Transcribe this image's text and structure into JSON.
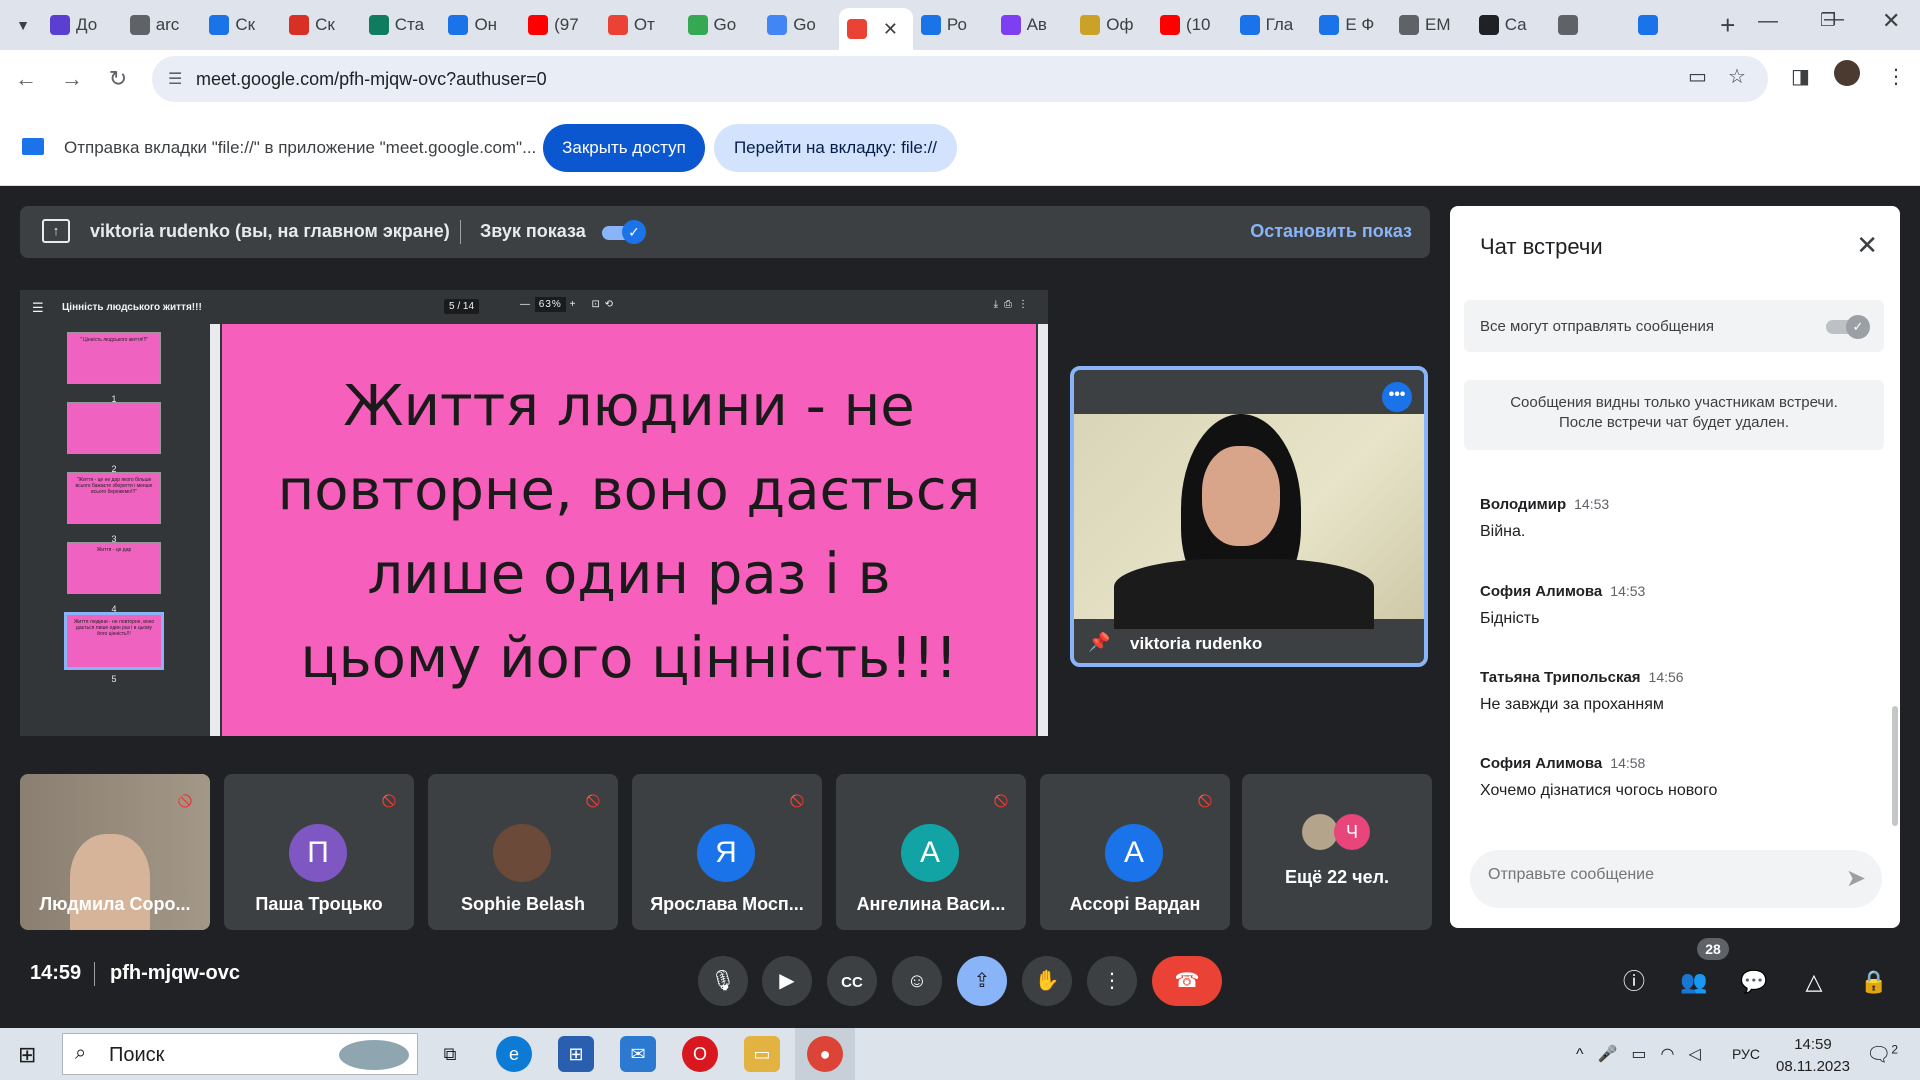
{
  "browser": {
    "tabs": [
      {
        "label": "До",
        "color": "#5b3fd1",
        "icon": "shield-icon"
      },
      {
        "label": "arc",
        "color": "#5f6368",
        "icon": "globe-icon"
      },
      {
        "label": "Ск",
        "color": "#1a73e8",
        "icon": "hand-icon"
      },
      {
        "label": "Ск",
        "color": "#d93025",
        "icon": "heart-icon"
      },
      {
        "label": "Ста",
        "color": "#0f7b5f",
        "icon": "sheet-icon"
      },
      {
        "label": "Он",
        "color": "#1a73e8",
        "icon": "circle-icon"
      },
      {
        "label": "(97",
        "color": "#ff0000",
        "icon": "youtube-icon"
      },
      {
        "label": "От",
        "color": "#ea4335",
        "icon": "gmail-icon"
      },
      {
        "label": "Go",
        "color": "#34a853",
        "icon": "classroom-icon"
      },
      {
        "label": "Go",
        "color": "#4285f4",
        "icon": "docs-icon"
      },
      {
        "label": "",
        "color": "#ea4335",
        "icon": "record-icon",
        "active": true
      },
      {
        "label": "Ро",
        "color": "#1a73e8",
        "icon": "dot-icon"
      },
      {
        "label": "Ав",
        "color": "#7e3ff2",
        "icon": "v-icon"
      },
      {
        "label": "Оф",
        "color": "#c9a227",
        "icon": "crest-icon"
      },
      {
        "label": "(10",
        "color": "#ff0000",
        "icon": "youtube-icon"
      },
      {
        "label": "Гла",
        "color": "#1a73e8",
        "icon": "c-icon"
      },
      {
        "label": "Е Ф",
        "color": "#1a73e8",
        "icon": "puzzle-icon"
      },
      {
        "label": "ЕМ",
        "color": "#5f6368",
        "icon": "doc-icon"
      },
      {
        "label": "Са",
        "color": "#202124",
        "icon": "wikipedia-icon"
      },
      {
        "label": "",
        "color": "#5f6368",
        "icon": "globe-icon"
      },
      {
        "label": "",
        "color": "#1a73e8",
        "icon": "window-icon"
      }
    ],
    "url": "meet.google.com/pfh-mjqw-ovc?authuser=0"
  },
  "infobar": {
    "message": "Отправка вкладки \"file://\" в приложение \"meet.google.com\"...",
    "close_access": "Закрыть доступ",
    "goto_tab": "Перейти на вкладку: file://"
  },
  "sharebar": {
    "presenter": "viktoria rudenko (вы, на главном экране)",
    "sound_label": "Звук показа",
    "sound_on": true,
    "stop_label": "Остановить показ"
  },
  "pdf": {
    "title": "Цінність людського життя!!!",
    "page": "5",
    "pages": "/ 14",
    "zoom": "63%",
    "slide_lines": [
      "Життя людини - не",
      "повторне, воно дається",
      "лише один раз і в",
      "цьому його цінність!!!"
    ],
    "thumbnails": [
      {
        "num": "1",
        "text": "\" Цінність людського життя!!!\""
      },
      {
        "num": "2",
        "text": ""
      },
      {
        "num": "3",
        "text": "\"Життя - це не дар якого більше всього бажаєте зберегти і менше всього бережемо!!!\""
      },
      {
        "num": "4",
        "text": "Життя - це дар"
      },
      {
        "num": "5",
        "text": "Життя людини - не повторне, воно дається лише один раз і в цьому його цінність!!!"
      }
    ]
  },
  "self_tile": {
    "name": "viktoria rudenko"
  },
  "participants": [
    {
      "name": "Людмила Соро...",
      "initial": "",
      "color": "#7a6a5a"
    },
    {
      "name": "Паша Троцько",
      "initial": "П",
      "color": "#7e57c2"
    },
    {
      "name": "Sophie Belash",
      "initial": "",
      "color": "#6b4a3a"
    },
    {
      "name": "Ярослава Мосп...",
      "initial": "Я",
      "color": "#1a73e8"
    },
    {
      "name": "Ангелина Васи...",
      "initial": "А",
      "color": "#12a4a4"
    },
    {
      "name": "Ассорі Вардан",
      "initial": "А",
      "color": "#1a73e8"
    }
  ],
  "more_participants": {
    "label": "Ещё 22 чел.",
    "initial": "Ч",
    "color": "#e8457a"
  },
  "chat": {
    "title": "Чат встречи",
    "permission": "Все могут отправлять сообщения",
    "note_line1": "Сообщения видны только участникам встречи.",
    "note_line2": "После встречи чат будет удален.",
    "messages": [
      {
        "sender": "Володимир",
        "time": "14:53",
        "text": "Війна."
      },
      {
        "sender": "София Алимова",
        "time": "14:53",
        "text": "Бідність"
      },
      {
        "sender": "Татьяна Трипольская",
        "time": "14:56",
        "text": "Не завжди за проханням"
      },
      {
        "sender": "София Алимова",
        "time": "14:58",
        "text": "Хочемо дізнатися чогось нового"
      }
    ],
    "input_placeholder": "Отправьте сообщение"
  },
  "controls": {
    "time": "14:59",
    "meeting_code": "pfh-mjqw-ovc",
    "people_count": "28"
  },
  "taskbar": {
    "search_placeholder": "Поиск",
    "lang": "РУС",
    "time": "14:59",
    "date": "08.11.2023",
    "notifications": "2"
  }
}
